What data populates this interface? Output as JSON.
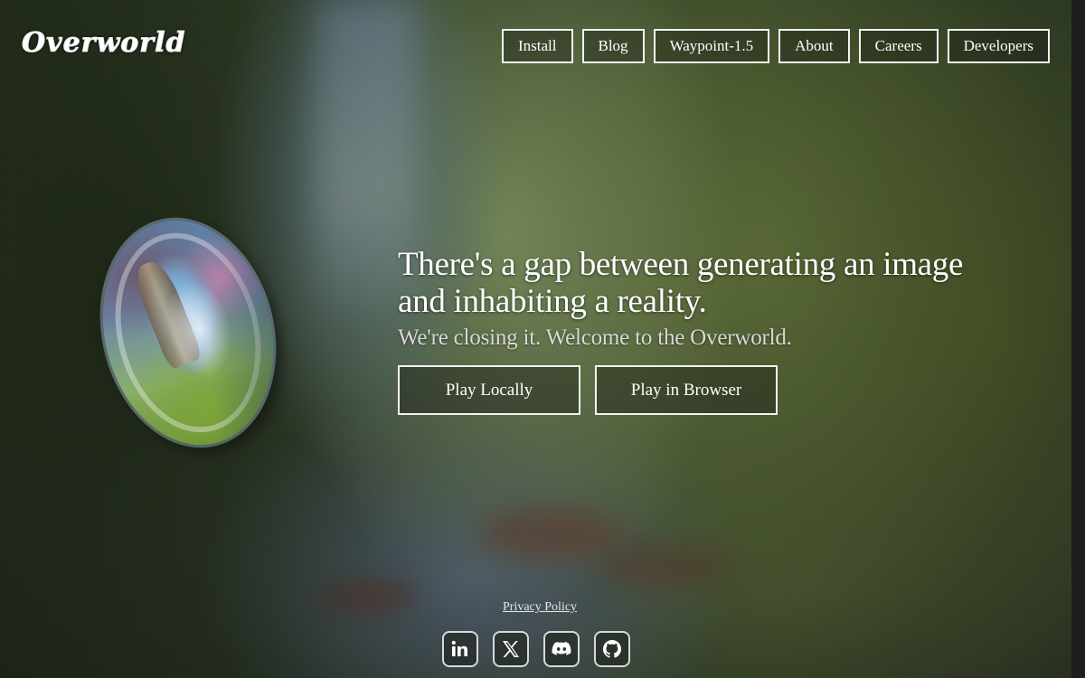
{
  "brand": {
    "name": "Overworld"
  },
  "nav": {
    "items": [
      {
        "label": "Install"
      },
      {
        "label": "Blog"
      },
      {
        "label": "Waypoint-1.5"
      },
      {
        "label": "About"
      },
      {
        "label": "Careers"
      },
      {
        "label": "Developers"
      }
    ]
  },
  "hero": {
    "headline": "There's a gap between generating an image and inhabiting a reality.",
    "subheadline": "We're closing it. Welcome to the Overworld.",
    "buttons": {
      "play_locally": "Play Locally",
      "play_in_browser": "Play in Browser"
    }
  },
  "footer": {
    "privacy_label": "Privacy Policy",
    "socials": [
      {
        "icon": "linkedin-icon"
      },
      {
        "icon": "x-icon"
      },
      {
        "icon": "discord-icon"
      },
      {
        "icon": "github-icon"
      }
    ]
  },
  "colors": {
    "text": "#ffffff",
    "button_border": "#f2f2f2",
    "subtext": "#d9d9d9"
  }
}
